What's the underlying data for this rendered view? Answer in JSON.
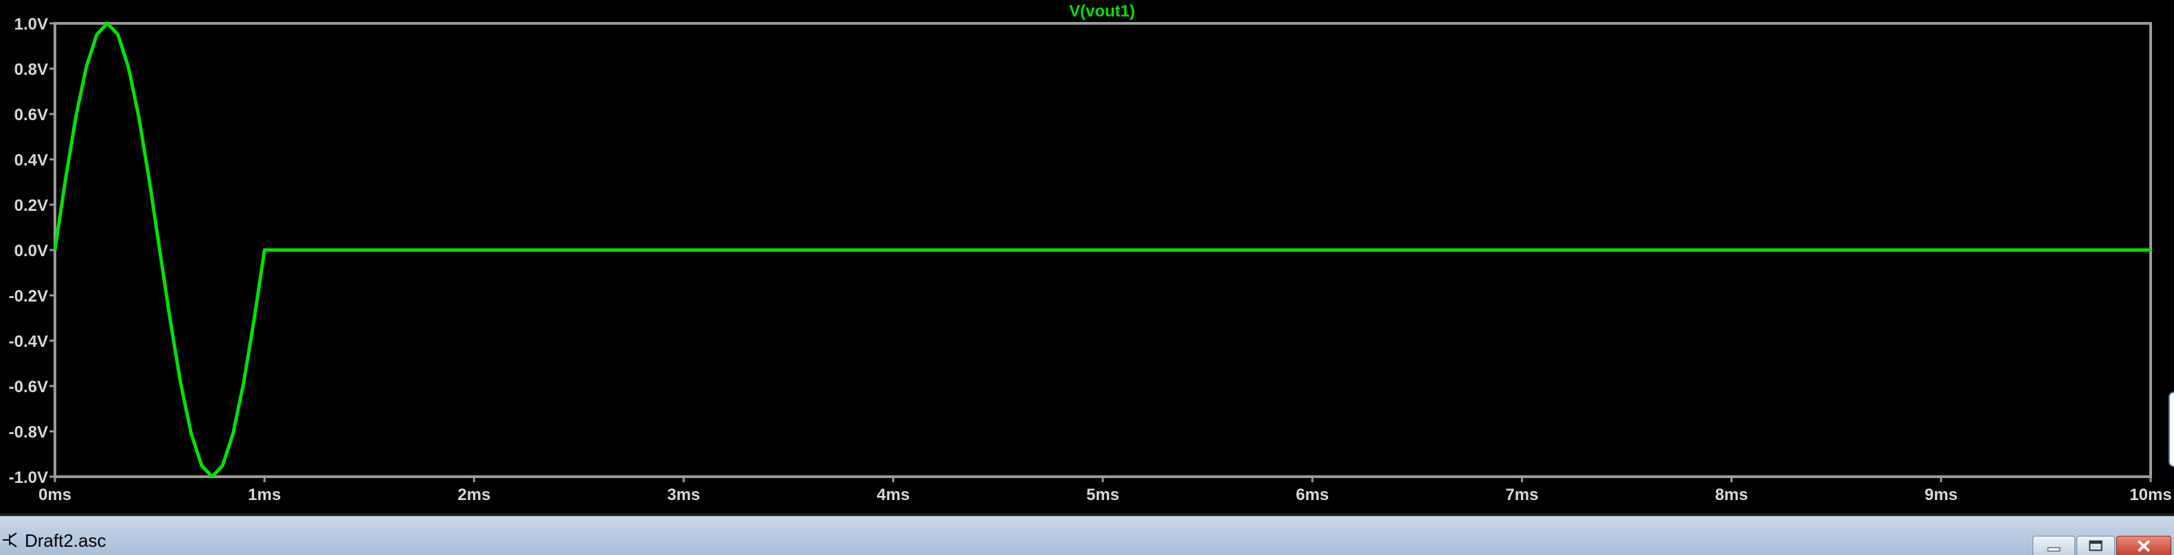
{
  "window": {
    "doc_title": "Draft2.asc"
  },
  "colors": {
    "background": "#000000",
    "trace": "#00e000",
    "axis": "#9a9a9a",
    "tick_text": "#d8d8d8"
  },
  "chart_data": {
    "type": "line",
    "title": "V(vout1)",
    "xlabel": "",
    "ylabel": "",
    "xlim": [
      0,
      10
    ],
    "ylim": [
      -1.0,
      1.0
    ],
    "grid": false,
    "x_ticks": [
      "0ms",
      "1ms",
      "2ms",
      "3ms",
      "4ms",
      "5ms",
      "6ms",
      "7ms",
      "8ms",
      "9ms",
      "10ms"
    ],
    "y_ticks": [
      "1.0V",
      "0.8V",
      "0.6V",
      "0.4V",
      "0.2V",
      "0.0V",
      "-0.2V",
      "-0.4V",
      "-0.6V",
      "-0.8V",
      "-1.0V"
    ],
    "series": [
      {
        "name": "V(vout1)",
        "x": [
          0,
          0.05,
          0.1,
          0.15,
          0.2,
          0.25,
          0.3,
          0.35,
          0.4,
          0.45,
          0.5,
          0.55,
          0.6,
          0.65,
          0.7,
          0.75,
          0.8,
          0.85,
          0.9,
          0.95,
          1.0,
          10.0
        ],
        "y": [
          0,
          0.309,
          0.588,
          0.809,
          0.951,
          1.0,
          0.951,
          0.809,
          0.588,
          0.309,
          0,
          -0.309,
          -0.588,
          -0.809,
          -0.951,
          -1.0,
          -0.951,
          -0.809,
          -0.588,
          -0.309,
          0,
          0
        ]
      }
    ]
  }
}
